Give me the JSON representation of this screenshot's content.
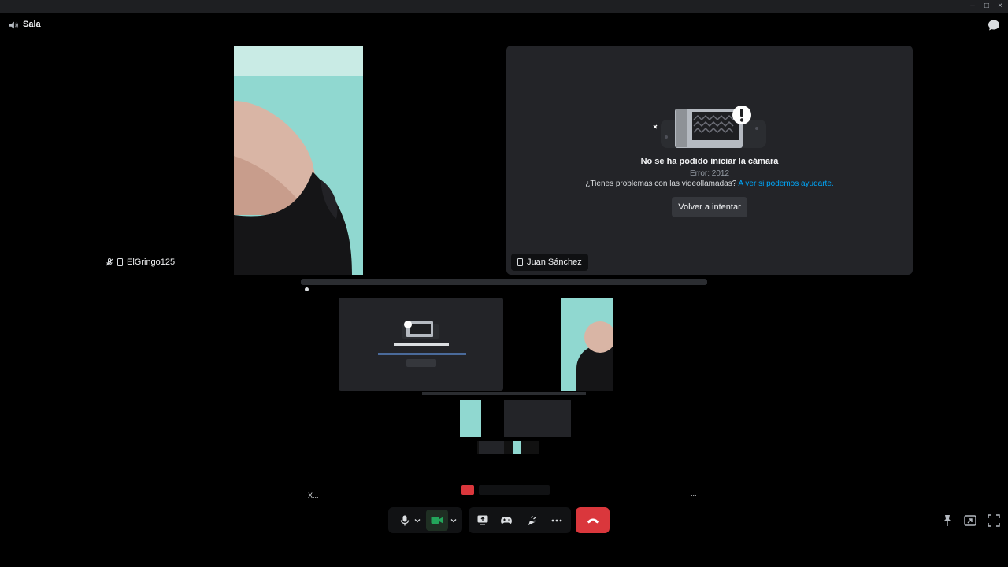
{
  "window": {
    "minimize": "–",
    "maximize": "□",
    "close": "×"
  },
  "header": {
    "title": "Sala",
    "speaker_icon": "speaker-icon",
    "chat_icon": "chat-bubble-icon"
  },
  "tiles": {
    "left": {
      "name": "ElGringo125",
      "icons": [
        "mic-muted-icon",
        "mobile-icon"
      ]
    },
    "right": {
      "name": "Juan Sánchez",
      "icons": [
        "mobile-icon"
      ],
      "error_title": "No se ha podido iniciar la cámara",
      "error_code": "Error: 2012",
      "help_text": "¿Tienes problemas con las videollamadas?",
      "help_link": "A ver si podemos ayudarte.",
      "retry_label": "Volver a intentar"
    }
  },
  "nested_preview": {
    "x_label": "X..."
  },
  "more_dots": "...",
  "controls": {
    "mic_icon": "microphone-icon",
    "camera_icon": "camera-icon",
    "screen_share_icon": "screen-share-icon",
    "activity_icon": "game-controller-icon",
    "soundboard_icon": "soundboard-icon",
    "more_icon": "more-icon",
    "hangup_icon": "hang-up-icon"
  },
  "accent": {
    "green": "#23a55a",
    "red": "#da373c",
    "link": "#00a8fc"
  }
}
